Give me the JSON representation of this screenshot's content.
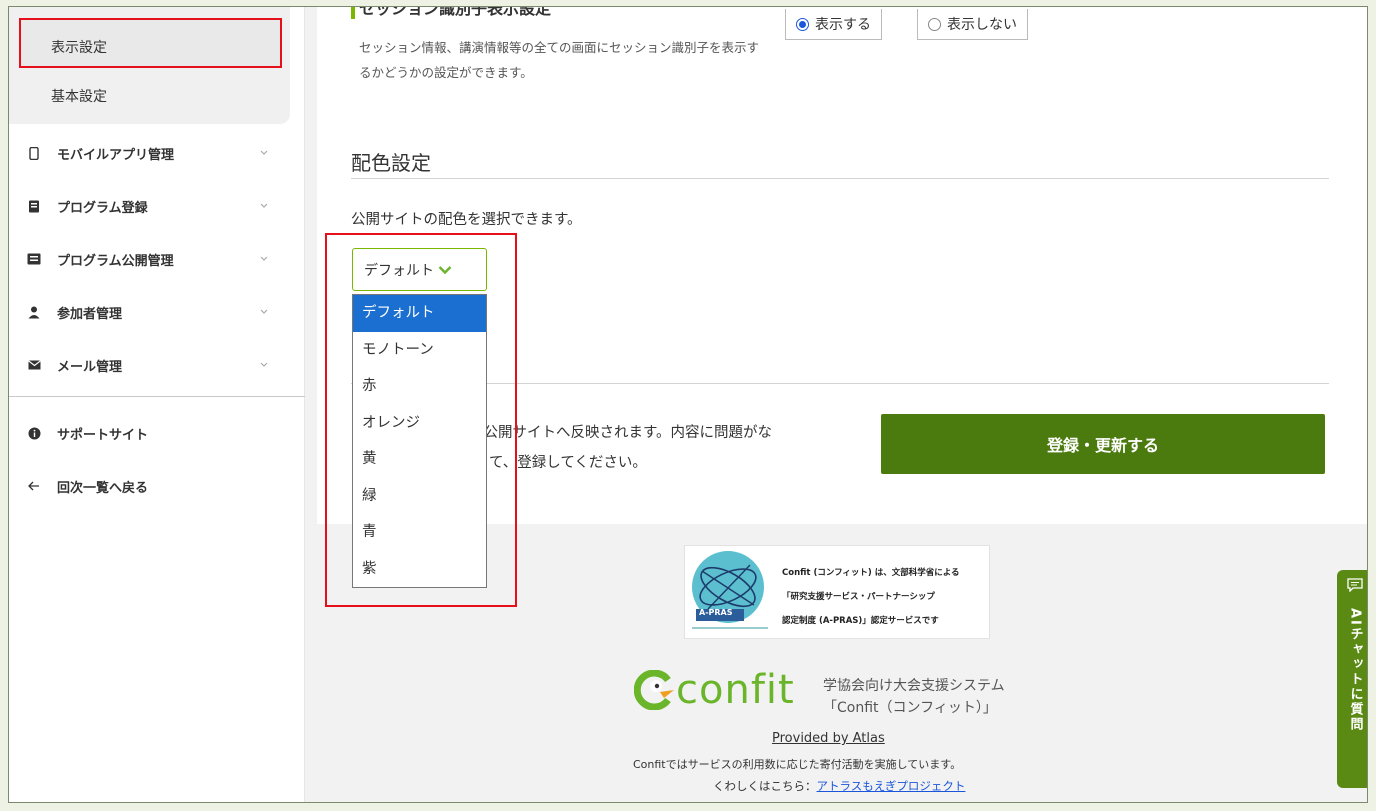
{
  "sidebar": {
    "sub_items": [
      "表示設定",
      "基本設定"
    ],
    "nav": [
      {
        "label": "モバイルアプリ管理",
        "icon": "mobile-icon"
      },
      {
        "label": "プログラム登録",
        "icon": "book-icon"
      },
      {
        "label": "プログラム公開管理",
        "icon": "list-icon"
      },
      {
        "label": "参加者管理",
        "icon": "user-icon"
      },
      {
        "label": "メール管理",
        "icon": "mail-icon"
      }
    ],
    "links": [
      {
        "label": "サポートサイト",
        "icon": "info-icon"
      },
      {
        "label": "回次一覧へ戻る",
        "icon": "arrow-left-icon"
      }
    ]
  },
  "session": {
    "title": "セッション識別子表示設定",
    "description": "セッション情報、講演情報等の全ての画面にセッション識別子を表示するかどうかの設定ができます。",
    "radio_show": "表示する",
    "radio_hide": "表示しない",
    "selected": "表示する"
  },
  "color": {
    "heading": "配色設定",
    "description": "公開サイトの配色を選択できます。",
    "selected": "デフォルト",
    "options": [
      "デフォルト",
      "モノトーン",
      "赤",
      "オレンジ",
      "黄",
      "緑",
      "青",
      "紫"
    ]
  },
  "submit": {
    "note_line1": "に公開サイトへ反映されます。内容に問題がな",
    "note_line2": "て、登録してください。",
    "button": "登録・更新する"
  },
  "footer": {
    "apras_label": "A-PRAS",
    "apras_line1": "Confit (コンフィット) は、文部科学省による",
    "apras_line2": "「研究支援サービス・パートナーシップ",
    "apras_line3": "認定制度 (A-PRAS)」認定サービスです",
    "logo": "confit",
    "logo_sub1": "学協会向け大会支援システム",
    "logo_sub2": "「Confit（コンフィット）」",
    "provided": "Provided by Atlas",
    "donation": "Confitではサービスの利用数に応じた寄付活動を実施しています。",
    "details_prefix": "くわしくはこちら：",
    "details_link": "アトラスもえぎプロジェクト"
  },
  "ai_tab": "AIチャットに質問",
  "colors": {
    "accent": "#4b7a0f",
    "highlight": "#e5101c",
    "select_blue": "#1a6fd0"
  }
}
